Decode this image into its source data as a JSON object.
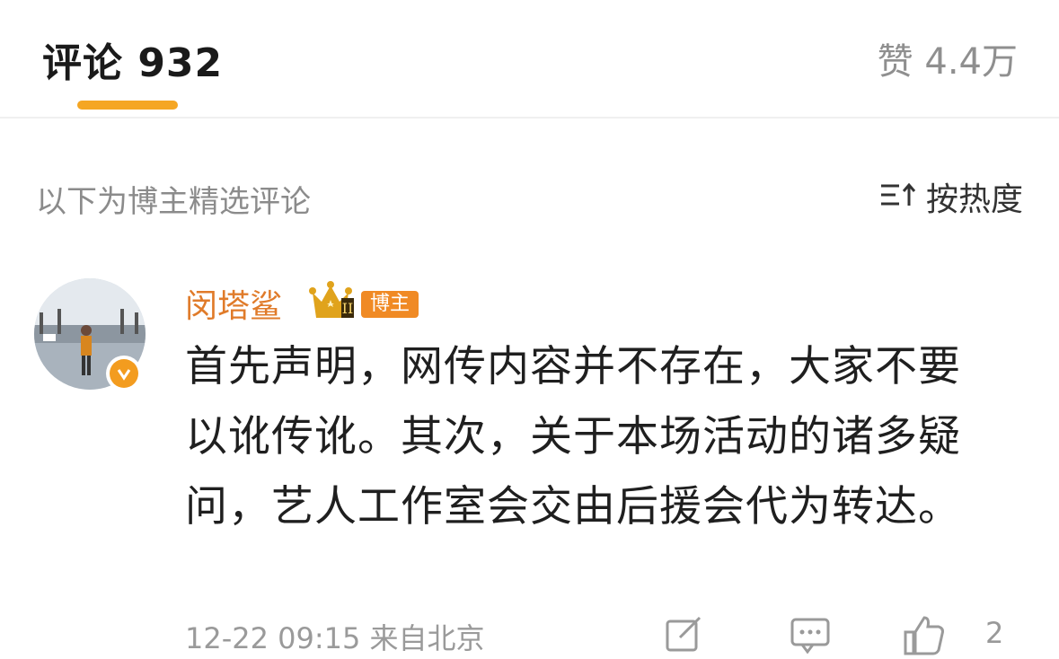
{
  "tabs": {
    "comments": "评论 932",
    "likes": "赞 4.4万",
    "accent_color": "#f5a623"
  },
  "section": {
    "label": "以下为博主精选评论",
    "sort_label": "按热度",
    "sort_icon": "sort-icon"
  },
  "comment": {
    "username": "闵塔鲨",
    "badge_icon": "crown-badge-icon",
    "blogger_tag": "博主",
    "verified_icon": "verified-icon",
    "text": "首先声明，网传内容并不存在，大家不要以讹传讹。其次，关于本场活动的诸多疑问，艺人工作室会交由后援会代为转达。",
    "timestamp": "12-22 09:15",
    "location": "来自北京",
    "actions": {
      "share_icon": "share-icon",
      "reply_icon": "comment-icon",
      "like_icon": "thumbs-up-icon",
      "like_count": "2"
    }
  }
}
